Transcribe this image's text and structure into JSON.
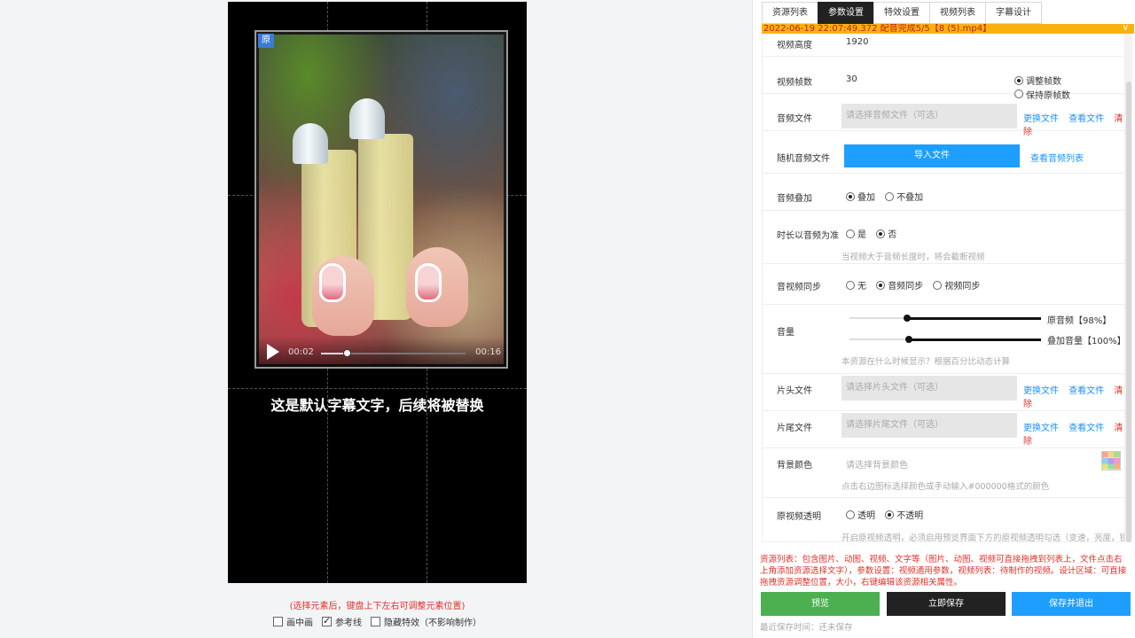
{
  "preview": {
    "badge": "原",
    "time_current": "00:02",
    "time_total": "00:16",
    "progress": 0.18,
    "subtitle": "这是默认字幕文字，后续将被替换",
    "hint": "(选择元素后，键盘上下左右可调整元素位置)",
    "options": [
      {
        "label": "画中画",
        "checked": false
      },
      {
        "label": "参考线",
        "checked": true
      },
      {
        "label": "隐藏特效（不影响制作）",
        "checked": false
      }
    ]
  },
  "tabs": [
    {
      "label": "资源列表",
      "active": false
    },
    {
      "label": "参数设置",
      "active": true
    },
    {
      "label": "特效设置",
      "active": false
    },
    {
      "label": "视频列表",
      "active": false
    },
    {
      "label": "字幕设计",
      "active": false
    }
  ],
  "status_text": "2022-06-19 22:07:49.372 配音完成5/5【8 (5).mp4】",
  "form": {
    "video_height": {
      "label": "视频高度",
      "value": "1920"
    },
    "video_fps": {
      "label": "视频帧数",
      "value": "30",
      "opt_adjust": "调整帧数",
      "opt_keep": "保持原帧数"
    },
    "audio_file": {
      "label": "音频文件",
      "placeholder": "请选择音频文件（可选）",
      "change": "更换文件",
      "view": "查看文件",
      "clear": "清除"
    },
    "random_audio": {
      "label": "随机音频文件",
      "import": "导入文件",
      "view_list": "查看音频列表"
    },
    "audio_overlay": {
      "label": "音频叠加",
      "opt_yes": "叠加",
      "opt_no": "不叠加"
    },
    "duration_by_audio": {
      "label": "时长以音频为准",
      "opt_yes": "是",
      "opt_no": "否",
      "note": "当视频大于音频长度时，将会截断视频"
    },
    "av_sync": {
      "label": "音视频同步",
      "opt_none": "无",
      "opt_audio": "音频同步",
      "opt_video": "视频同步"
    },
    "volume": {
      "label": "音量",
      "original_label": "原音频【98%】",
      "original_value": 0.98,
      "overlay_label": "叠加音量【100%】",
      "overlay_value": 1.0,
      "note": "本资源在什么时候显示？根据百分比动态计算"
    },
    "intro_file": {
      "label": "片头文件",
      "placeholder": "请选择片头文件（可选）",
      "change": "更换文件",
      "view": "查看文件",
      "clear": "清除"
    },
    "outro_file": {
      "label": "片尾文件",
      "placeholder": "请选择片尾文件（可选）",
      "change": "更换文件",
      "view": "查看文件",
      "clear": "清除"
    },
    "bg_color": {
      "label": "背景颜色",
      "placeholder": "请选择背景颜色",
      "note": "点击右边图标选择颜色或手动输入#000000格式的颜色"
    },
    "orig_transparent": {
      "label": "原视频透明",
      "opt_yes": "透明",
      "opt_no": "不透明",
      "note": "开启原视频透明，必须启用预览界面下方的原视频透明勾选（变速，亮度，锐"
    }
  },
  "description": "资源列表：包含图片、动图、视频、文字等（图片、动图、视频可直接拖拽到列表上，文件点击右上角添加资源选择文字），参数设置：视频通用参数，视频列表：待制作的视频。设计区域：可直接拖拽资源调整位置，大小，右键编辑该资源相关属性。",
  "buttons": {
    "preview": "预览",
    "save": "立即保存",
    "save_exit": "保存并退出"
  },
  "last_saved": "最近保存时间：还未保存",
  "colors": {
    "preview_btn": "#4cb050",
    "save_btn": "#222222",
    "exit_btn": "#1e9fff",
    "accent": "#1e90ff",
    "warning": "#e0312b"
  }
}
